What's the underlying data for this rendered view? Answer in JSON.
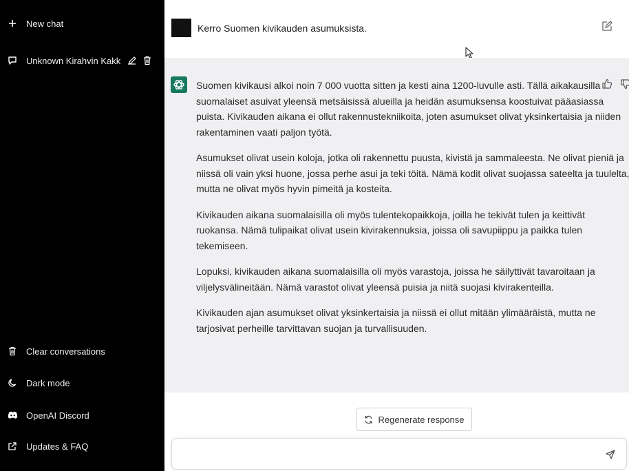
{
  "sidebar": {
    "new_chat": "New chat",
    "conversation": "Unknown Kirahvin Kakk",
    "clear": "Clear conversations",
    "dark_mode": "Dark mode",
    "discord": "OpenAI Discord",
    "faq": "Updates & FAQ"
  },
  "chat": {
    "user_message": "Kerro Suomen kivikauden asumuksista.",
    "response_paragraphs": [
      "Suomen kivikausi alkoi noin 7 000 vuotta sitten ja kesti aina 1200-luvulle asti. Tällä aikakausilla suomalaiset asuivat yleensä metsäisissä alueilla ja heidän asumuksensa koostuivat pääasiassa puista. Kivikauden aikana ei ollut rakennustekniikoita, joten asumukset olivat yksinkertaisia ja niiden rakentaminen vaati paljon työtä.",
      "Asumukset olivat usein koloja, jotka oli rakennettu puusta, kivistä ja sammaleesta. Ne olivat pieniä ja niissä oli vain yksi huone, jossa perhe asui ja teki töitä. Nämä kodit olivat suojassa sateelta ja tuulelta, mutta ne olivat myös hyvin pimeitä ja kosteita.",
      "Kivikauden aikana suomalaisilla oli myös tulentekopaikkoja, joilla he tekivät tulen ja keittivät ruokansa. Nämä tulipaikat olivat usein kivirakennuksia, joissa oli savupiippu ja paikka tulen tekemiseen.",
      "Lopuksi, kivikauden aikana suomalaisilla oli myös varastoja, joissa he säilyttivät tavaroitaan ja viljelysvälineitään. Nämä varastot olivat yleensä puisia ja niitä suojasi kivirakenteilla.",
      "Kivikauden ajan asumukset olivat yksinkertaisia ja niissä ei ollut mitään ylimääräistä, mutta ne tarjosivat perheille tarvittavan suojan ja turvallisuuden."
    ]
  },
  "regenerate_label": "Regenerate response",
  "input": {
    "value": "",
    "placeholder": ""
  },
  "colors": {
    "sidebar_bg": "#000000",
    "response_bg": "#f0f0f2",
    "bot_avatar": "#16795f"
  }
}
